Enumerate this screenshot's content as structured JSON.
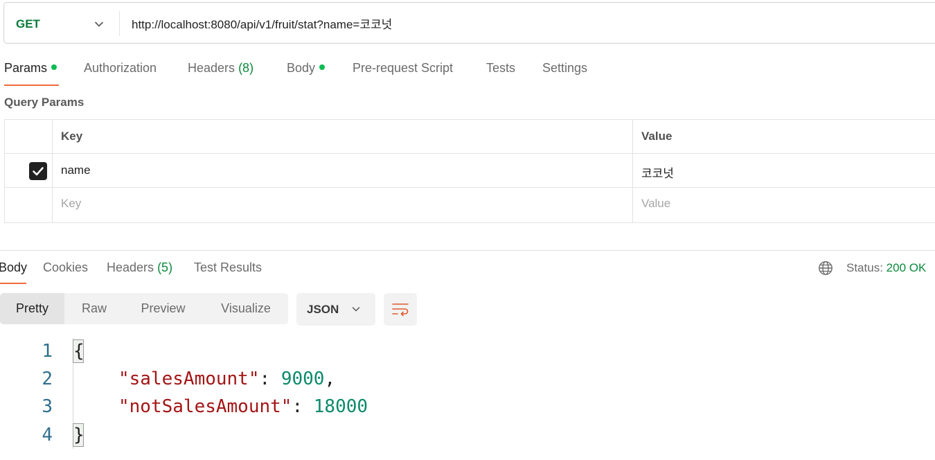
{
  "request": {
    "method": "GET",
    "url": "http://localhost:8080/api/v1/fruit/stat?name=코코넛"
  },
  "request_tabs": {
    "params": "Params",
    "authorization": "Authorization",
    "headers": "Headers",
    "headers_count": "(8)",
    "body": "Body",
    "pre_request_script": "Pre-request Script",
    "tests": "Tests",
    "settings": "Settings"
  },
  "query_params": {
    "title": "Query Params",
    "headers": {
      "key": "Key",
      "value": "Value"
    },
    "rows": [
      {
        "key": "name",
        "value": "코코넛",
        "checked": true
      }
    ],
    "placeholder": {
      "key": "Key",
      "value": "Value"
    }
  },
  "response_tabs": {
    "body": "Body",
    "cookies": "Cookies",
    "headers": "Headers",
    "headers_count": "(5)",
    "test_results": "Test Results"
  },
  "status": {
    "label": "Status:",
    "code": "200 OK"
  },
  "view_modes": {
    "pretty": "Pretty",
    "raw": "Raw",
    "preview": "Preview",
    "visualize": "Visualize"
  },
  "format": "JSON",
  "response_body": {
    "line_numbers": [
      "1",
      "2",
      "3",
      "4"
    ],
    "open_brace": "{",
    "close_brace": "}",
    "fields": [
      {
        "key": "\"salesAmount\"",
        "value": "9000",
        "trail": ","
      },
      {
        "key": "\"notSalesAmount\"",
        "value": "18000",
        "trail": ""
      }
    ],
    "colon": ": "
  },
  "colors": {
    "accent_underline": "#f26b3a",
    "method_get": "#0b7a3b",
    "status_ok": "#0b8a3b",
    "json_key": "#a31515",
    "json_number": "#0b8a6b"
  }
}
